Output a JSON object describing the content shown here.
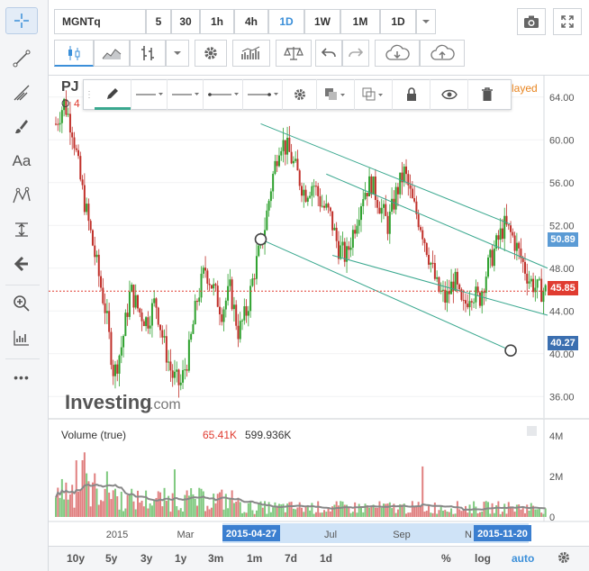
{
  "left_toolbar": {
    "tools": [
      {
        "name": "crosshair-icon",
        "label": ""
      },
      {
        "name": "line-tool-icon",
        "label": ""
      },
      {
        "name": "fork-tool-icon",
        "label": ""
      },
      {
        "name": "brush-tool-icon",
        "label": ""
      },
      {
        "name": "text-tool-icon",
        "label": "Aa"
      },
      {
        "name": "pattern-tool-icon",
        "label": ""
      },
      {
        "name": "measure-tool-icon",
        "label": ""
      },
      {
        "name": "arrow-left-icon",
        "label": ""
      },
      {
        "name": "zoom-in-icon",
        "label": ""
      },
      {
        "name": "indicator-icon",
        "label": ""
      },
      {
        "name": "more-icon",
        "label": "•••"
      }
    ]
  },
  "top_toolbar": {
    "symbol": "MGNTq",
    "intervals": [
      "5",
      "30",
      "1h",
      "4h",
      "1D",
      "1W",
      "1M",
      "1D"
    ],
    "selected_interval": "1D"
  },
  "legend": {
    "symbol_prefix": "PJ",
    "open_prefix": "O",
    "open_value_fragment": "4",
    "delayed_fragment": "layed"
  },
  "watermark": {
    "brand": "Investing",
    "suffix": ".com"
  },
  "price_axis": {
    "ticks": [
      "64.00",
      "60.00",
      "56.00",
      "52.00",
      "48.00",
      "44.00",
      "40.00",
      "36.00"
    ],
    "tags": [
      {
        "label": "50.89",
        "color": "#5b9bd5"
      },
      {
        "label": "45.85",
        "color": "#e03c31"
      },
      {
        "label": "40.27",
        "color": "#3b6fb0"
      }
    ]
  },
  "volume_panel": {
    "title": "Volume (true)",
    "value_red": "65.41K",
    "value_dark": "599.936K",
    "axis_ticks": [
      "4M",
      "2M",
      "0"
    ]
  },
  "time_axis": {
    "labels": [
      "2015",
      "Mar",
      "Jul",
      "Sep",
      "N"
    ],
    "highlight_start": "2015-04-27",
    "highlight_end": "2015-11-20"
  },
  "bottom_bar": {
    "ranges": [
      "10y",
      "5y",
      "3y",
      "1y",
      "3m",
      "1m",
      "7d",
      "1d"
    ],
    "right_options": [
      "%",
      "log",
      "auto"
    ]
  },
  "colors": {
    "up": "#2ea12e",
    "down": "#c0302a",
    "channel": "#3aa88f",
    "accent": "#3b8fd9"
  },
  "chart_data": {
    "type": "candlestick",
    "ylim": [
      34.0,
      66.0
    ],
    "y_ticks": [
      36,
      40,
      44,
      48,
      52,
      56,
      60,
      64
    ],
    "x_labels": [
      "2015",
      "Mar",
      "Jul",
      "Sep",
      "N"
    ],
    "last_price": 45.85,
    "channel_levels": [
      50.89,
      40.27
    ],
    "approx_close_path": [
      61.5,
      63.5,
      61,
      56,
      52,
      48,
      44,
      38,
      41,
      46,
      44,
      43,
      45,
      41,
      38,
      37,
      40,
      45,
      48,
      46,
      44,
      46,
      42,
      44,
      48,
      51,
      56,
      60,
      59,
      57,
      55,
      56,
      54,
      53,
      50,
      49,
      52,
      55,
      56,
      54,
      52,
      55,
      57,
      54,
      52,
      49,
      46,
      45,
      47,
      44,
      46,
      45,
      48,
      50,
      52,
      51,
      49,
      47,
      46,
      45.85
    ],
    "volume_axis_ticks": [
      "4M",
      "2M",
      "0"
    ]
  }
}
